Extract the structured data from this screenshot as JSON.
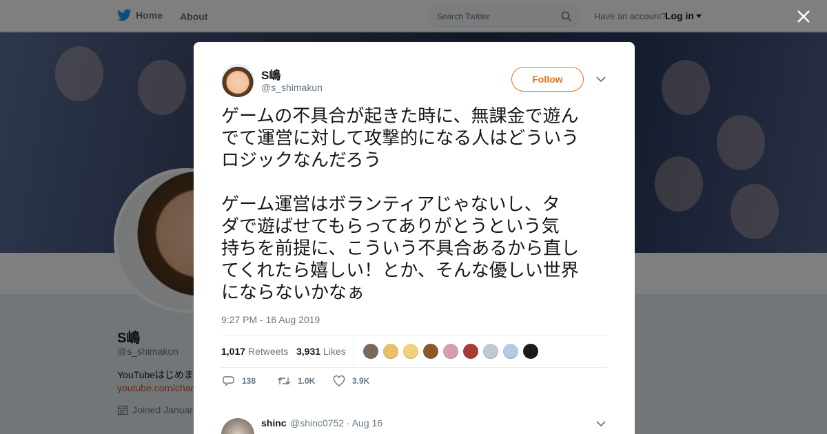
{
  "nav": {
    "home_label": "Home",
    "about_label": "About",
    "search_placeholder": "Search Twitter",
    "have_account": "Have an account?",
    "login_label": "Log in"
  },
  "profile": {
    "name": "S嶋",
    "handle": "@s_shimakun",
    "bio": "YouTubeはじめま",
    "link": "youtube.com/char",
    "joined": "Joined Januar"
  },
  "tweet": {
    "author_name": "S嶋",
    "author_handle": "@s_shimakun",
    "follow_label": "Follow",
    "text": "ゲームの不具合が起きた時に、無課金で遊ん\nでて運営に対して攻撃的になる人はどういう\nロジックなんだろう\n\nゲーム運営はボランティアじゃないし、タ\nダで遊ばせてもらってありがとうという気\n持ちを前提に、こういう不具合あるから直し\nてくれたら嬉しい！とか、そんな優しい世界\nにならないかなぁ",
    "timestamp": "9:27 PM - 16 Aug 2019",
    "retweets_count": "1,017",
    "retweets_label": "Retweets",
    "likes_count": "3,931",
    "likes_label": "Likes",
    "reply_count": "138",
    "retweet_count_short": "1.0K",
    "like_count_short": "3.9K"
  },
  "likers": [
    "#7a6a5a",
    "#e8c06a",
    "#f0d27a",
    "#8a5a2a",
    "#d4a0b0",
    "#a83a3a",
    "#c0c8d0",
    "#b8c8e8",
    "#1a1a1a"
  ],
  "reply": {
    "name": "shinc",
    "meta": "@shinc0752 · Aug 16"
  },
  "colors": {
    "accent": "#e0701f",
    "twitter_blue": "#1da1f2",
    "muted": "#657786"
  }
}
